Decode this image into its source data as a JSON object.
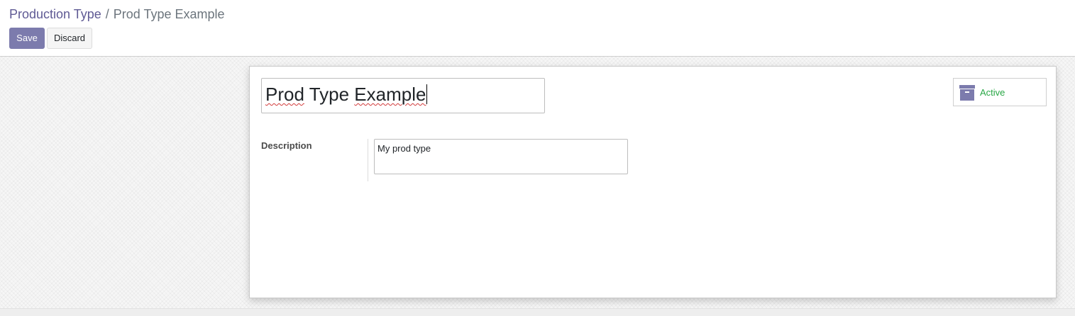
{
  "breadcrumb": {
    "parent": "Production Type",
    "separator": "/",
    "current": "Prod Type Example"
  },
  "toolbar": {
    "save_label": "Save",
    "discard_label": "Discard"
  },
  "form": {
    "name_words": [
      "Prod",
      "Type",
      "Example"
    ],
    "active_label": "Active",
    "active_icon": "archive-box-icon",
    "description_label": "Description",
    "description_value": "My prod type"
  },
  "colors": {
    "brand": "#7c7bad",
    "breadcrumb_link": "#5f5a94",
    "active_text": "#28a745"
  }
}
